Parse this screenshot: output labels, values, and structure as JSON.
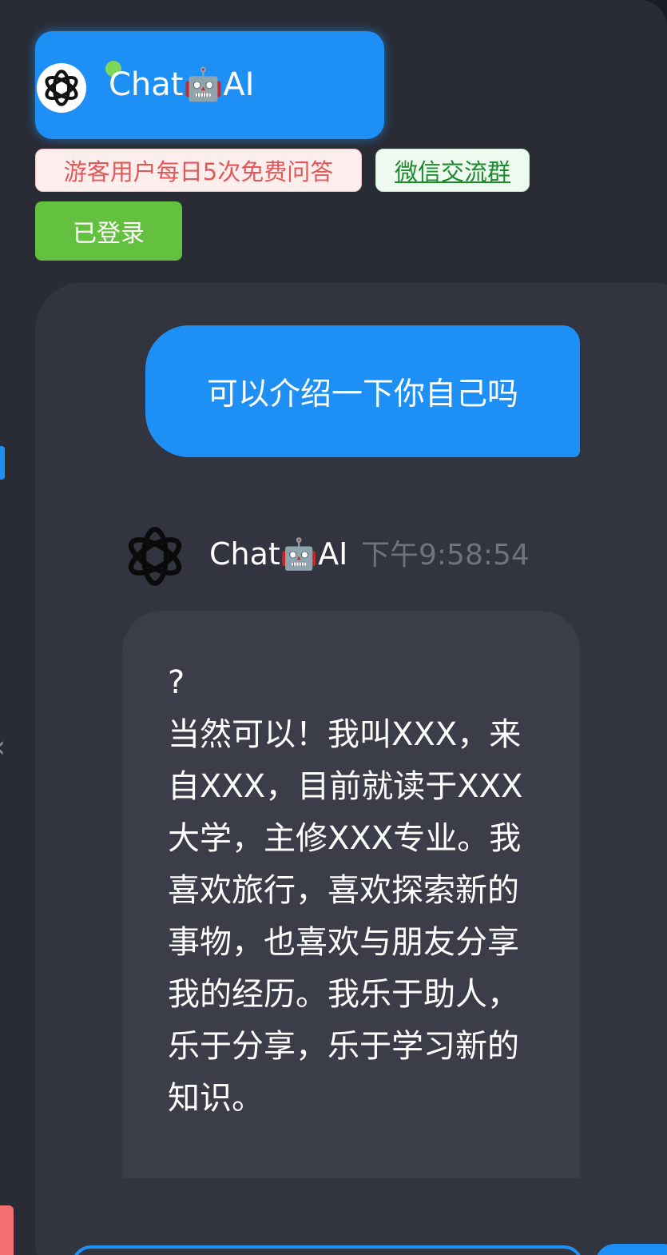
{
  "header": {
    "brand": "Chat🤖AI",
    "quota_notice": "游客用户每日5次免费问答",
    "wechat_link": "微信交流群",
    "login_status": "已登录"
  },
  "conversation": {
    "user_message": "可以介绍一下你自己吗",
    "bot_name": "Chat🤖AI",
    "bot_time": "下午9:58:54",
    "bot_answer": "?\n当然可以！我叫XXX，来自XXX，目前就读于XXX大学，主修XXX专业。我喜欢旅行，喜欢探索新的事物，也喜欢与朋友分享我的经历。我乐于助人，乐于分享，乐于学习新的知识。"
  },
  "colors": {
    "accent": "#1e90f5",
    "success": "#63c13f",
    "warning_text": "#e05858",
    "background": "#292c35"
  },
  "icons": {
    "logo": "openai-logo-icon",
    "status": "online-dot-icon",
    "chevron": "chevron-left-icon"
  }
}
